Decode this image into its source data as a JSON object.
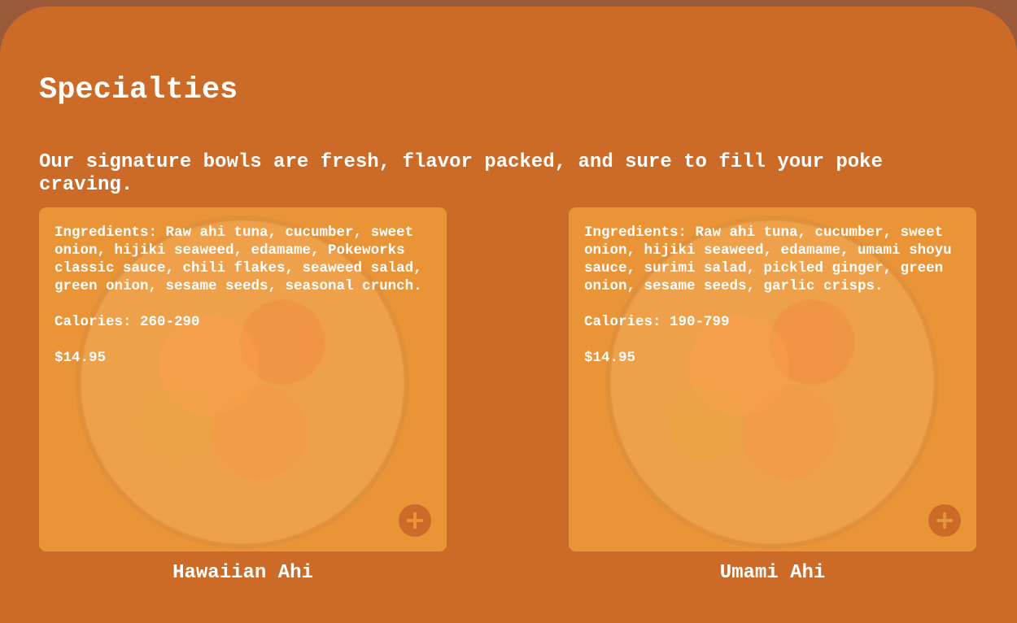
{
  "section": {
    "title": "Specialties",
    "subtitle": "Our signature bowls are fresh, flavor packed, and sure to fill your poke craving."
  },
  "colors": {
    "page_background": "#9a5a3a",
    "panel_background": "#cc6b28",
    "card_background": "#ea9438",
    "text": "#ffffff"
  },
  "items": [
    {
      "name": "Hawaiian Ahi",
      "ingredients": "Ingredients: Raw ahi tuna, cucumber, sweet onion, hijiki seaweed, edamame, Pokeworks classic sauce, chili flakes, seaweed salad, green onion, sesame seeds, seasonal crunch.",
      "calories": "Calories: 260-290",
      "price": "$14.95",
      "add_icon": "plus-icon"
    },
    {
      "name": "Umami Ahi",
      "ingredients": "Ingredients: Raw ahi tuna, cucumber, sweet onion, hijiki seaweed, edamame, umami shoyu sauce, surimi salad, pickled ginger, green onion, sesame seeds, garlic crisps.",
      "calories": "Calories: 190-799",
      "price": "$14.95",
      "add_icon": "plus-icon"
    }
  ]
}
